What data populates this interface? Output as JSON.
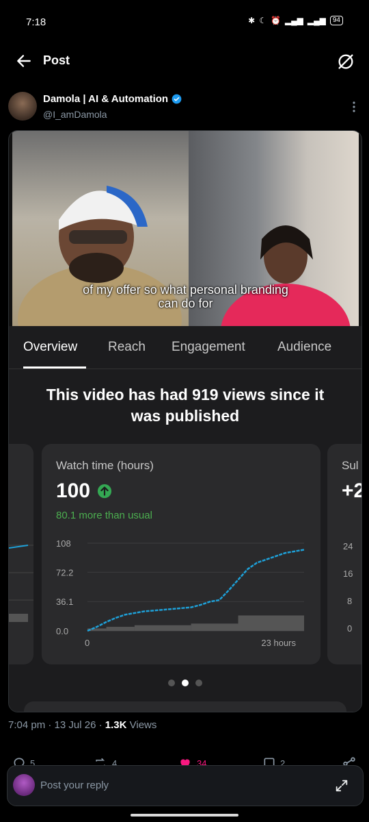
{
  "status_bar": {
    "time": "7:18",
    "battery": "94"
  },
  "header": {
    "title": "Post"
  },
  "author": {
    "name": "Damola | AI & Automation",
    "handle": "@I_amDamola"
  },
  "video": {
    "caption_line1": "of my offer so what personal branding",
    "caption_line2": "can do for"
  },
  "analytics": {
    "tabs": [
      {
        "label": "Overview"
      },
      {
        "label": "Reach"
      },
      {
        "label": "Engagement"
      },
      {
        "label": "Audience"
      }
    ],
    "headline_line1": "This video has had 919 views since it",
    "headline_line2": "was published",
    "card": {
      "title": "Watch time (hours)",
      "value": "100",
      "delta": "80.1 more than usual"
    },
    "right_card": {
      "title_fragment": "Sul",
      "value_fragment": "+2",
      "ticks": [
        "24",
        "16",
        "8",
        "0"
      ]
    }
  },
  "chart_data": {
    "type": "line",
    "title": "Watch time (hours)",
    "x_ticks": [
      "0",
      "23 hours"
    ],
    "y_ticks": [
      "108",
      "72.2",
      "36.1",
      "0.0"
    ],
    "ylim": [
      0,
      108
    ],
    "xlim": [
      0,
      23
    ],
    "series": [
      {
        "values_x": [
          0,
          1,
          2,
          3,
          4,
          5,
          6,
          7,
          8,
          9,
          10,
          11,
          12,
          13,
          14,
          15,
          16,
          17,
          18,
          19,
          20,
          21,
          22,
          23
        ],
        "values_y": [
          0,
          5,
          11,
          16,
          20,
          22,
          24,
          25,
          26,
          27,
          28,
          29,
          32,
          36,
          38,
          50,
          63,
          76,
          84,
          88,
          92,
          96,
          98,
          100
        ]
      }
    ],
    "bars": [
      {
        "x_start": 0,
        "x_end": 2,
        "value": 3
      },
      {
        "x_start": 2,
        "x_end": 5,
        "value": 5
      },
      {
        "x_start": 5,
        "x_end": 11,
        "value": 7
      },
      {
        "x_start": 11,
        "x_end": 16,
        "value": 9
      },
      {
        "x_start": 16,
        "x_end": 23,
        "value": 19
      }
    ],
    "colors": {
      "line": "#1ea1d9",
      "bars": "#555555"
    }
  },
  "pager": {
    "count": 3,
    "active": 1
  },
  "post_meta": {
    "time": "7:04 pm",
    "date": "13 Jul 26",
    "views_count": "1.3K",
    "views_label": "Views"
  },
  "actions": {
    "replies": "5",
    "reposts": "4",
    "likes": "34",
    "bookmarks": "2"
  },
  "reply_bar": {
    "placeholder": "Post your reply"
  }
}
